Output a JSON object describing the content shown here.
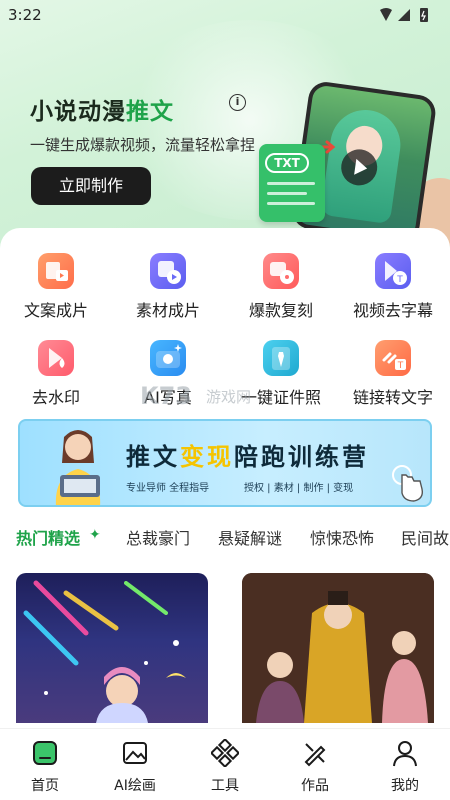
{
  "status": {
    "time": "3:22"
  },
  "hero": {
    "title_prefix": "小说动漫",
    "title_highlight": "推文",
    "info_glyph": "i",
    "subtitle": "一键生成爆款视频，流量轻松拿捏",
    "cta_label": "立即制作",
    "card_tag": "TXT"
  },
  "tools": [
    {
      "label": "文案成片",
      "icon": "document-video-icon",
      "color": "#ff8a5b"
    },
    {
      "label": "素材成片",
      "icon": "media-video-icon",
      "color": "#6b6cf6"
    },
    {
      "label": "爆款复刻",
      "icon": "film-reel-icon",
      "color": "#ff6b6b"
    },
    {
      "label": "视频去字幕",
      "icon": "subtitle-remove-icon",
      "color": "#6b6cf6"
    },
    {
      "label": "去水印",
      "icon": "watermark-remove-icon",
      "color": "#ff6b7a"
    },
    {
      "label": "AI写真",
      "icon": "ai-camera-icon",
      "color": "#3aa7ff"
    },
    {
      "label": "一键证件照",
      "icon": "id-photo-icon",
      "color": "#27b5d9"
    },
    {
      "label": "链接转文字",
      "icon": "link-to-text-icon",
      "color": "#ff7a52"
    }
  ],
  "banner": {
    "title_a": "推文",
    "title_b": "变现",
    "title_c": "陪跑训练营",
    "sub_left": "专业导师 全程指导",
    "sub_right": "授权 | 素材 | 制作 | 变现"
  },
  "tabs": [
    {
      "label": "热门精选",
      "active": true
    },
    {
      "label": "总裁豪门",
      "active": false
    },
    {
      "label": "悬疑解谜",
      "active": false
    },
    {
      "label": "惊悚恐怖",
      "active": false
    },
    {
      "label": "民间故",
      "active": false
    }
  ],
  "watermark": {
    "text": "游戏网"
  },
  "nav": [
    {
      "label": "首页",
      "icon": "home-icon"
    },
    {
      "label": "AI绘画",
      "icon": "ai-paint-icon"
    },
    {
      "label": "工具",
      "icon": "tools-icon"
    },
    {
      "label": "作品",
      "icon": "works-icon"
    },
    {
      "label": "我的",
      "icon": "profile-icon"
    }
  ],
  "colors": {
    "accent": "#1fa34a",
    "dark_button": "#1c1c1c"
  }
}
